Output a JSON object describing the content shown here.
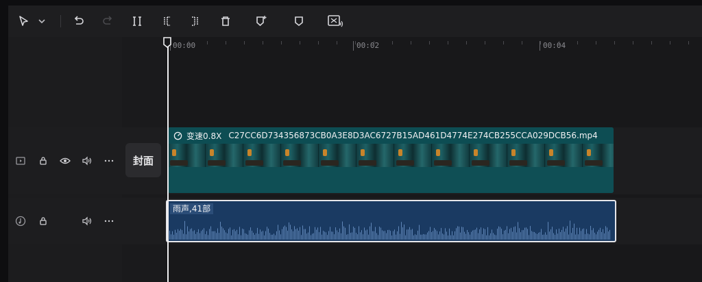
{
  "toolbar": {
    "icons": [
      "select-pointer-icon",
      "chevron-down-icon",
      "undo-icon",
      "redo-icon",
      "split-icon",
      "trim-left-icon",
      "trim-right-icon",
      "delete-icon",
      "marker-add-icon",
      "marker-icon",
      "freeze-audio-icon"
    ]
  },
  "ruler": {
    "labels": [
      "00:00",
      "00:02",
      "00:04"
    ]
  },
  "cover": {
    "label": "封面"
  },
  "video_clip": {
    "speed": "变速0.8X",
    "filename": "C27CC6D734356873CB0A3E8D3AC6727B15AD461D4774E274CB255CCA029DCB56.mp4"
  },
  "audio_clip": {
    "label": "雨声,41部"
  },
  "colors": {
    "video": "#0f4f55",
    "audio": "#1a3a62",
    "accent": "#f0f0f2"
  }
}
